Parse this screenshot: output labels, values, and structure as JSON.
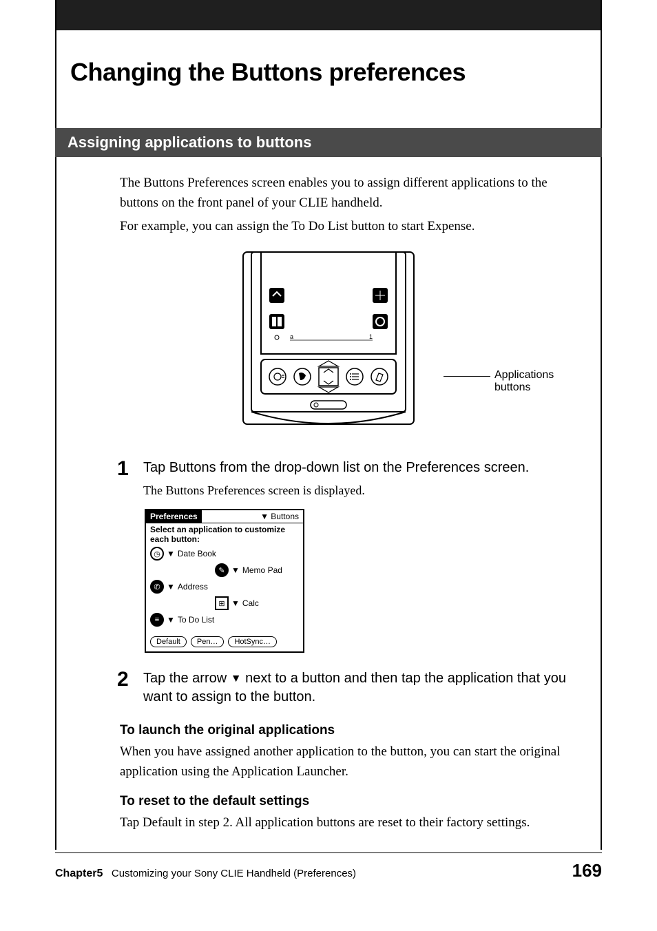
{
  "page": {
    "title": "Changing the Buttons preferences",
    "section_heading": "Assigning applications to buttons",
    "intro": [
      "The Buttons Preferences screen enables you to assign different applications to the buttons on the front panel of your CLIE handheld.",
      "For example, you can assign the To Do List button to start Expense."
    ],
    "callout": "Applications buttons",
    "steps": [
      {
        "num": "1",
        "title": "Tap Buttons from the drop-down list on the Preferences screen.",
        "desc": "The Buttons Preferences screen is displayed."
      },
      {
        "num": "2",
        "title_parts": [
          "Tap the arrow ",
          " next to a button and then tap the application that you want to assign to the button."
        ],
        "arrow": "▼"
      }
    ],
    "subsections": [
      {
        "heading": "To launch the original applications",
        "body": "When you have assigned another application to the button, you can start the original application using the Application Launcher."
      },
      {
        "heading": "To reset to the default settings",
        "body": "Tap Default in step 2. All application buttons are reset to their factory settings."
      }
    ],
    "prefs_screen": {
      "title": "Preferences",
      "menu": "Buttons",
      "instruction": "Select an application to customize each button:",
      "items": [
        "Date Book",
        "Memo Pad",
        "Address",
        "Calc",
        "To Do List"
      ],
      "buttons": [
        "Default",
        "Pen…",
        "HotSync…"
      ]
    },
    "footer": {
      "chapter_label": "Chapter5",
      "chapter_text": "Customizing your Sony CLIE Handheld (Preferences)",
      "page_number": "169"
    }
  }
}
